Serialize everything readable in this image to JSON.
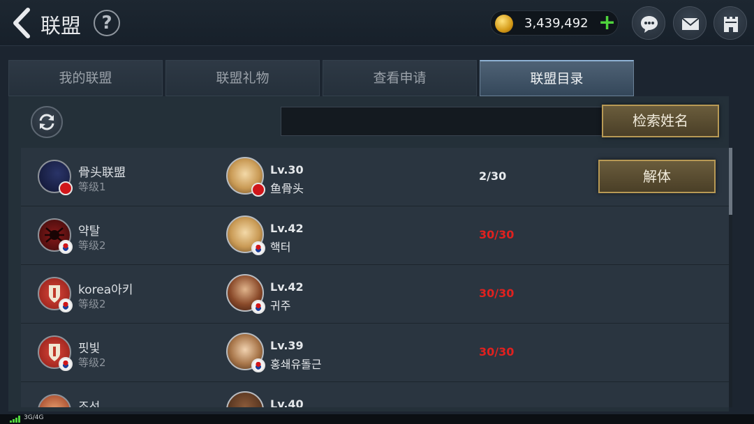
{
  "header": {
    "title": "联盟",
    "help_label": "?",
    "currency_amount": "3,439,492",
    "plus_label": "+"
  },
  "tabs": [
    {
      "label": "我的联盟",
      "active": false
    },
    {
      "label": "联盟礼物",
      "active": false
    },
    {
      "label": "查看申请",
      "active": false
    },
    {
      "label": "联盟目录",
      "active": true
    }
  ],
  "search": {
    "value": "",
    "button_label": "检索姓名"
  },
  "dissolve_label": "解体",
  "alliances": [
    {
      "name": "骨头联盟",
      "level": "等级1",
      "leader_level": "Lv.30",
      "leader_name": "鱼骨头",
      "members": "2/30",
      "flag": "cn",
      "full": false
    },
    {
      "name": "약탈",
      "level": "等级2",
      "leader_level": "Lv.42",
      "leader_name": "핵터",
      "members": "30/30",
      "flag": "kr",
      "full": true
    },
    {
      "name": "korea아키",
      "level": "等级2",
      "leader_level": "Lv.42",
      "leader_name": "귀주",
      "members": "30/30",
      "flag": "kr",
      "full": true
    },
    {
      "name": "핏빛",
      "level": "等级2",
      "leader_level": "Lv.39",
      "leader_name": "홍쇄유돌근",
      "members": "30/30",
      "flag": "kr",
      "full": true
    },
    {
      "name": "조선",
      "level": "",
      "leader_level": "Lv.40",
      "leader_name": "",
      "members": "",
      "flag": "kr",
      "full": true
    }
  ],
  "status_bar": {
    "network": "3G/4G"
  },
  "colors": {
    "members_open": "#e9ecef",
    "members_full": "#e0211f",
    "accent_gold": "#b89a55",
    "active_tab": "#8fb2d4"
  }
}
